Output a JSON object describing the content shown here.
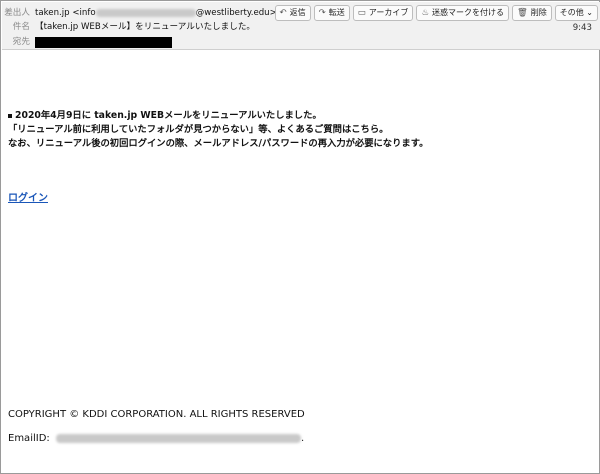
{
  "header": {
    "from_label": "差出人",
    "from_name": "taken.jp <info",
    "from_domain": "@westliberty.edu>",
    "subject_label": "件名",
    "subject": "【taken.jp WEBメール】をリニューアルいたしました。",
    "to_label": "宛先",
    "time": "9:43"
  },
  "toolbar": [
    {
      "icon": "reply-icon",
      "glyph": "↶",
      "label": "返信"
    },
    {
      "icon": "forward-icon",
      "glyph": "↷",
      "label": "転送"
    },
    {
      "icon": "archive-icon",
      "glyph": "▭",
      "label": "アーカイブ"
    },
    {
      "icon": "junk-flame-icon",
      "glyph": "♨",
      "label": "迷惑マークを付ける"
    },
    {
      "icon": "trash-icon",
      "glyph": "🗑",
      "label": "削除"
    },
    {
      "icon": "chevron-down-icon",
      "glyph": "",
      "label": "その他 ⌄"
    }
  ],
  "body": {
    "line1": "2020年4月9日に taken.jp WEBメールをリニューアルいたしました。",
    "line2": "「リニューアル前に利用していたフォルダが見つからない」等、よくあるご質問はこちら。",
    "line3": "なお、リニューアル後の初回ログインの際、メールアドレス/パスワードの再入力が必要になります。",
    "login_link": "ログイン",
    "copyright": "COPYRIGHT © KDDI CORPORATION. ALL RIGHTS RESERVED",
    "emailid_label": "EmailID:",
    "emailid_suffix": "."
  }
}
